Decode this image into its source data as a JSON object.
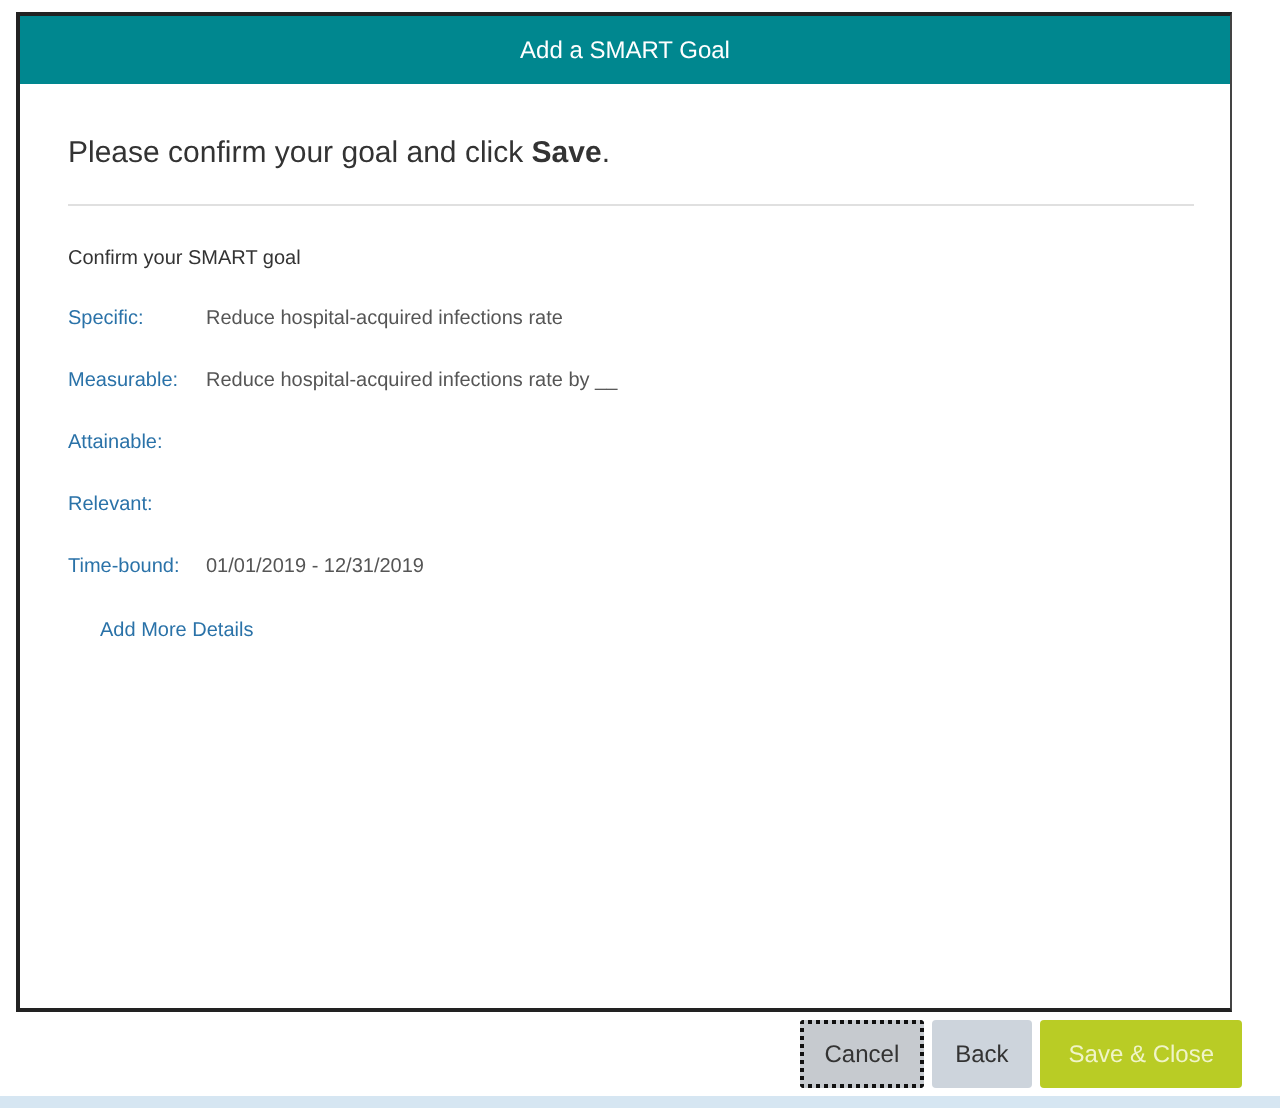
{
  "dialog": {
    "title": "Add a SMART Goal"
  },
  "instruction": "Please confirm your goal and click **Save**.",
  "section_title": "Confirm your SMART goal",
  "fields": [
    {
      "label": "Specific:",
      "value": "Reduce hospital-acquired infections rate"
    },
    {
      "label": "Measurable:",
      "value": "Reduce hospital-acquired infections rate by __"
    },
    {
      "label": "Attainable:"
    },
    {
      "label": "Relevant:"
    },
    {
      "label": "Time-bound:",
      "value": "01/01/2019 - 12/31/2019"
    }
  ],
  "add_details_link": "Add More Details",
  "buttons": [
    {
      "label": "Cancel",
      "kind": "secondary",
      "focused": true
    },
    {
      "label": "Back",
      "kind": "secondary",
      "focused": false
    },
    {
      "label": "Save & Close",
      "kind": "primary",
      "focused": false
    }
  ]
}
